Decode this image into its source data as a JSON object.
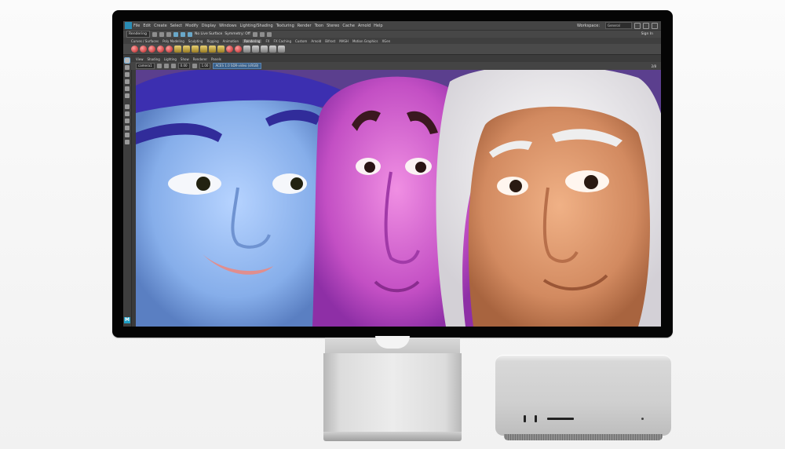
{
  "app": {
    "menus": [
      "File",
      "Edit",
      "Create",
      "Select",
      "Modify",
      "Display",
      "Windows",
      "Lighting/Shading",
      "Texturing",
      "Render",
      "Toon",
      "Stereo",
      "Cache",
      "Arnold",
      "Help"
    ],
    "workspace_label": "Workspace:",
    "workspace_value": "General",
    "mode_value": "Rendering",
    "no_live_surface": "No Live Surface",
    "symmetry": "Symmetry: Off",
    "sign_in": "Sign In"
  },
  "shelf": {
    "tabs": [
      "Curves / Surfaces",
      "Poly Modeling",
      "Sculpting",
      "Rigging",
      "Animation",
      "Rendering",
      "FX",
      "FX Caching",
      "Custom",
      "Arnold",
      "Bifrost",
      "MASH",
      "Motion Graphics",
      "XGen"
    ],
    "active_tab": "Rendering"
  },
  "panel": {
    "menus": [
      "View",
      "Shading",
      "Lighting",
      "Show",
      "Renderer",
      "Panels"
    ],
    "camera": "camera1",
    "value_a": "0.00",
    "value_b": "1.00",
    "color_space": "ACES 1.0 SDR-video (sRGB)",
    "end_value": "2/8"
  },
  "colors": {
    "accent": "#2b8db5",
    "ui_bg": "#444444",
    "viewport_bg": "#6d4fa0"
  },
  "icons": [
    "select-tool-icon",
    "lasso-tool-icon",
    "paint-tool-icon",
    "move-tool-icon",
    "rotate-tool-icon",
    "scale-tool-icon",
    "layout-icon",
    "maya-logo-icon"
  ]
}
